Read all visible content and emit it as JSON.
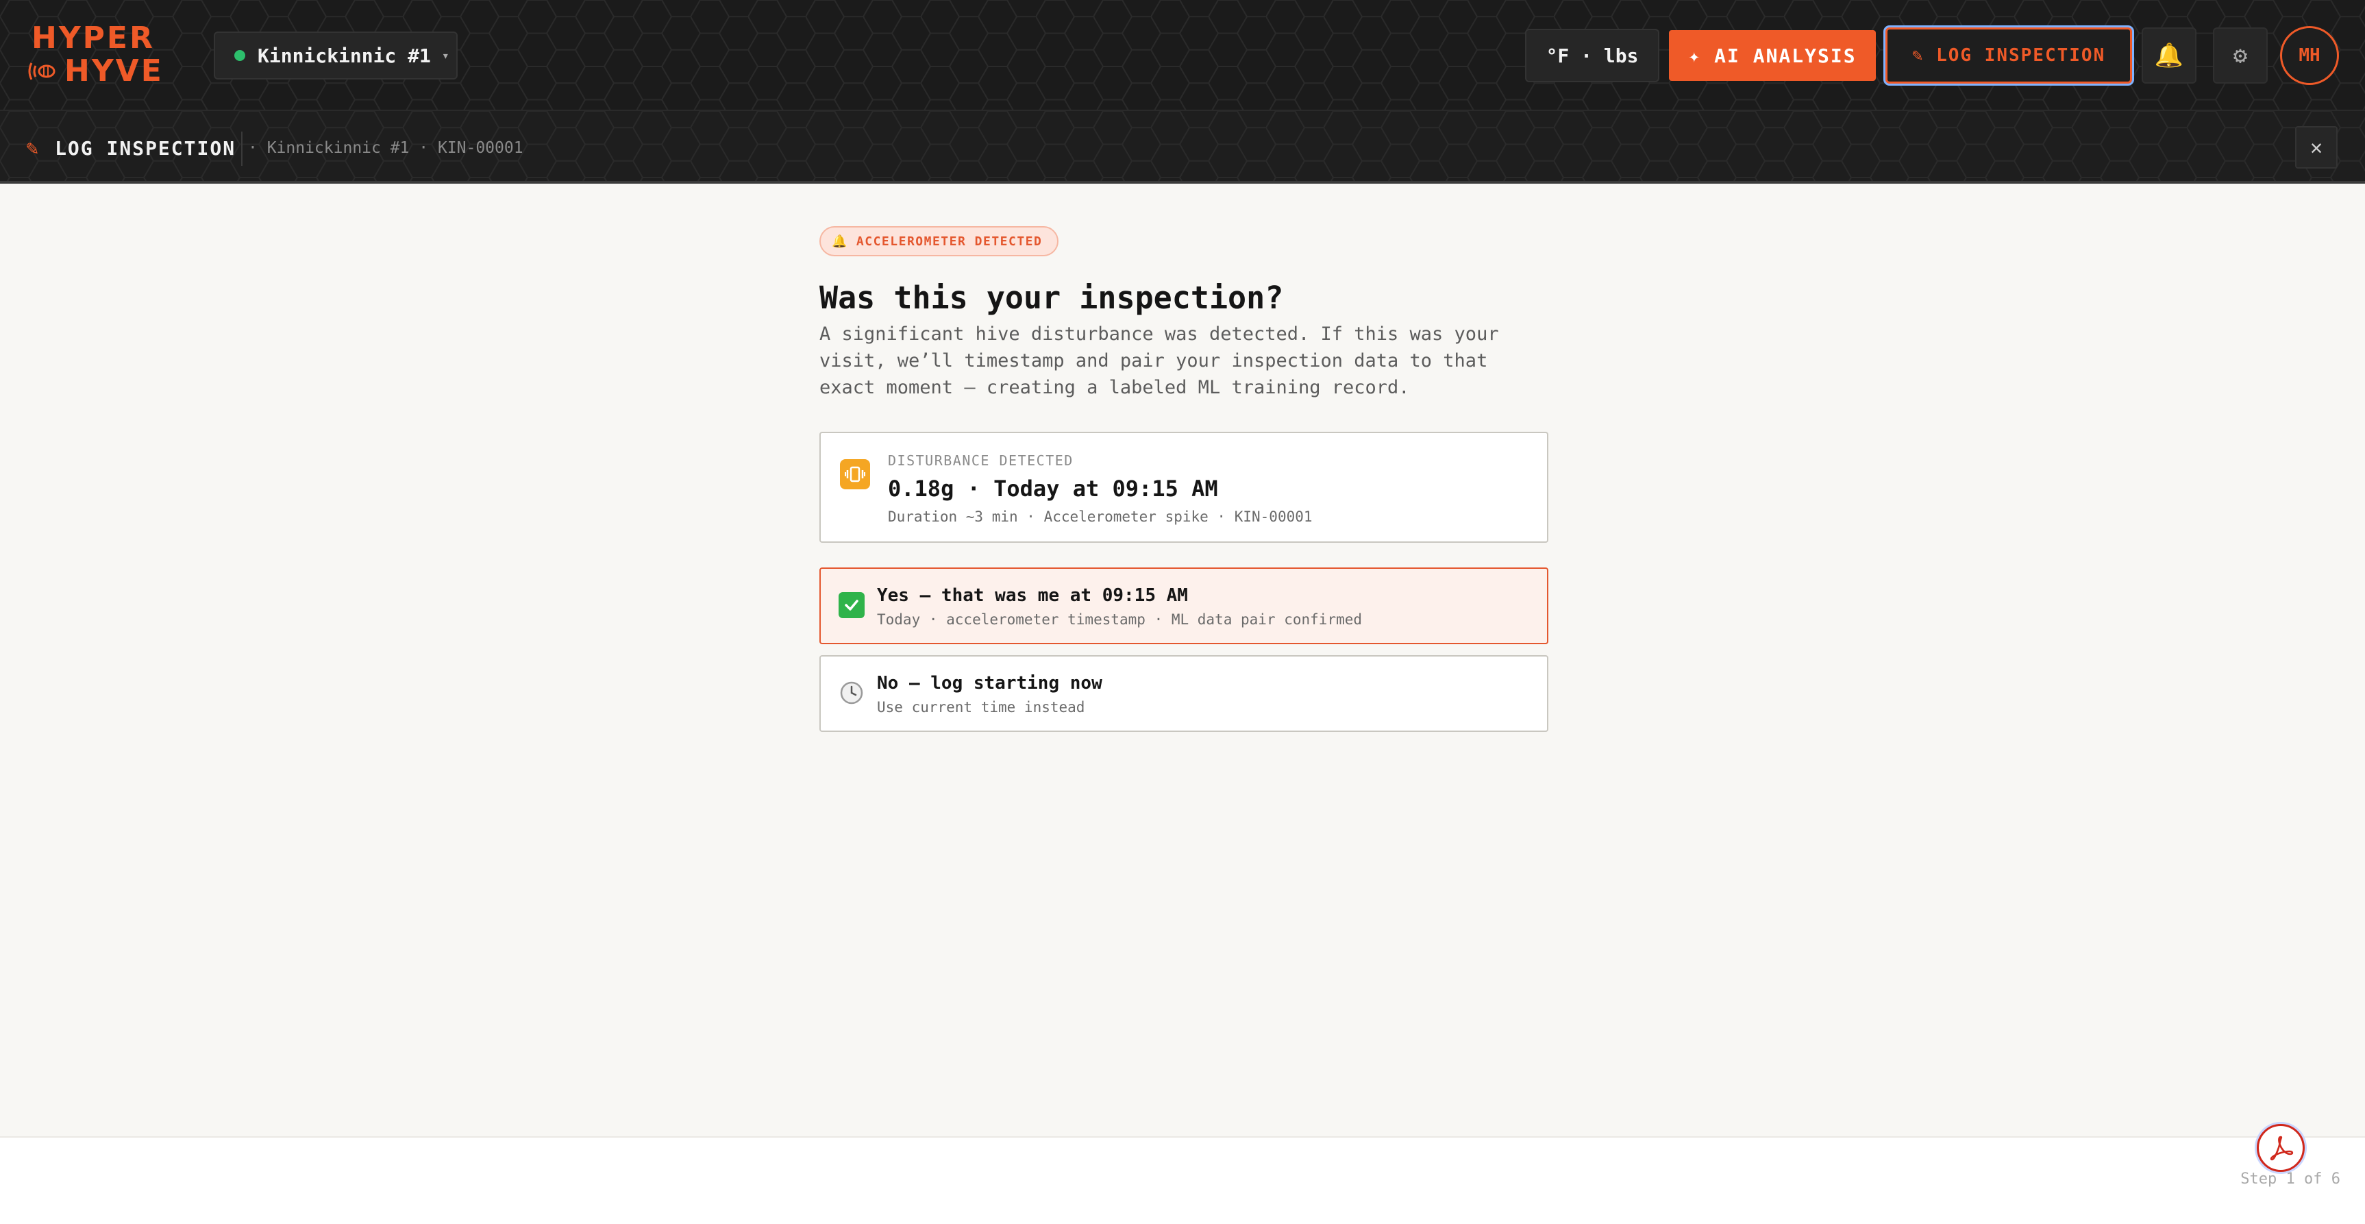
{
  "app": {
    "logo_line1": "HYPER",
    "logo_line2": "HYVE",
    "brand_color": "#ef5a28"
  },
  "header": {
    "hive_name": "Kinnickinnic #1",
    "hive_status_color": "#2dbf6c",
    "units": "°F · lbs",
    "ai_button": "✦ AI ANALYSIS",
    "log_button": "✎ LOG INSPECTION",
    "user_initials": "MH",
    "icons": [
      "bell-icon",
      "gear-icon"
    ]
  },
  "subheader": {
    "title": "LOG INSPECTION",
    "breadcrumb": "· Kinnickinnic #1 · KIN-00001",
    "close": "✕"
  },
  "main": {
    "badge": "ACCELEROMETER DETECTED",
    "title": "Was this your inspection?",
    "description": "A significant hive disturbance was detected. If this was your visit, we’ll timestamp and pair your inspection data to that exact moment — creating a labeled ML training record.",
    "disturbance": {
      "label": "DISTURBANCE DETECTED",
      "value": "0.18g · Today at 09:15 AM",
      "meta": "Duration ~3 min · Accelerometer spike · KIN-00001"
    },
    "options": [
      {
        "title": "Yes — that was me at 09:15 AM",
        "subtitle": "Today · accelerometer timestamp · ML data pair confirmed",
        "selected": true,
        "icon": "check-icon"
      },
      {
        "title": "No — log starting now",
        "subtitle": "Use current time instead",
        "selected": false,
        "icon": "clock-icon"
      }
    ]
  },
  "footer": {
    "step": "Step 1 of 6"
  }
}
